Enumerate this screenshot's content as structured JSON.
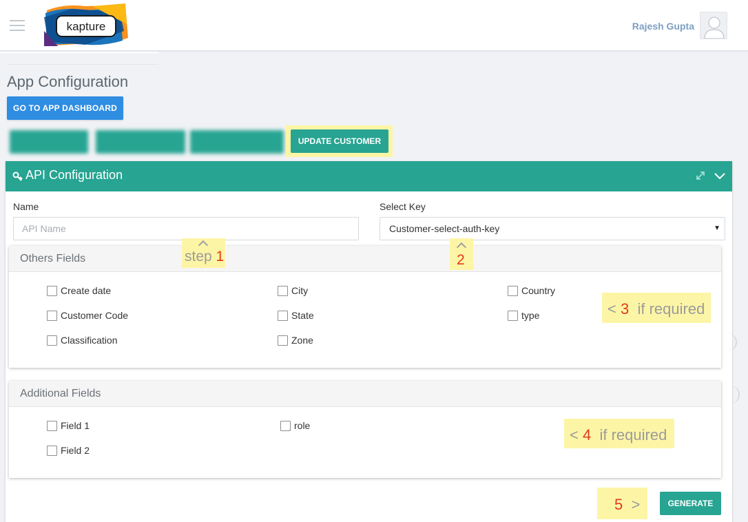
{
  "header": {
    "logo_text": "kapture",
    "user_name": "Rajesh Gupta"
  },
  "page": {
    "title": "App Configuration",
    "dashboard_button": "GO TO APP DASHBOARD",
    "update_customer_button": "UPDATE CUSTOMER"
  },
  "panel": {
    "title": "API Configuration",
    "name_label": "Name",
    "name_placeholder": "API Name",
    "select_key_label": "Select Key",
    "select_key_value": "Customer-select-auth-key"
  },
  "others_fields": {
    "title": "Others Fields",
    "items": [
      "Create date",
      "City",
      "Country",
      "Customer Code",
      "State",
      "type",
      "Classification",
      "Zone"
    ]
  },
  "additional_fields": {
    "title": "Additional Fields",
    "items": [
      "Field 1",
      "role",
      "Field 2"
    ]
  },
  "generate_button": "GENERATE",
  "annotations": {
    "step1_word": "step",
    "step1_num": "1",
    "step2_num": "2",
    "step3_num": "3",
    "step3_text": "if required",
    "step4_num": "4",
    "step4_text": "if required",
    "step5_num": "5"
  },
  "colors": {
    "teal": "#27a492",
    "blue": "#2f8de2",
    "highlight": "#fdf5a6",
    "annotation_number": "#e23a1b"
  },
  "icons": [
    "menu-icon",
    "user-avatar-icon",
    "key-icon",
    "expand-icon",
    "chevron-down-icon",
    "dropdown-caret-icon",
    "chevron-up-icon",
    "chevron-left-icon",
    "chevron-right-icon"
  ]
}
